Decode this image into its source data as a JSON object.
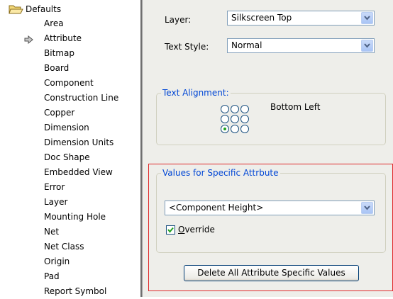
{
  "tree": {
    "root_label": "Defaults",
    "root_icon": "open-folder-icon",
    "selected_marker_icon": "arrow-right-icon",
    "items": [
      {
        "label": "Area"
      },
      {
        "label": "Attribute",
        "current": true
      },
      {
        "label": "Bitmap"
      },
      {
        "label": "Board"
      },
      {
        "label": "Component"
      },
      {
        "label": "Construction Line"
      },
      {
        "label": "Copper"
      },
      {
        "label": "Dimension"
      },
      {
        "label": "Dimension Units"
      },
      {
        "label": "Doc Shape"
      },
      {
        "label": "Embedded View"
      },
      {
        "label": "Error"
      },
      {
        "label": "Layer"
      },
      {
        "label": "Mounting Hole"
      },
      {
        "label": "Net"
      },
      {
        "label": "Net Class"
      },
      {
        "label": "Origin"
      },
      {
        "label": "Pad"
      },
      {
        "label": "Report Symbol"
      }
    ]
  },
  "settings": {
    "layer_label": "Layer:",
    "layer_value": "Silkscreen Top",
    "text_style_label": "Text Style:",
    "text_style_value": "Normal"
  },
  "text_alignment": {
    "title": "Text Alignment:",
    "selected_text": "Bottom  Left",
    "selected_position": "bottom-left"
  },
  "specific_values": {
    "title": "Values for Specific Attrbute",
    "attribute_value": "<Component Height>",
    "override_label_underlined": "O",
    "override_label_rest": "verride",
    "override_checked": true,
    "delete_button_label": "Delete All Attribute Specific Values"
  },
  "colors": {
    "group_title": "#0046d5",
    "highlight_frame": "#e0292b",
    "panel_background": "#eeeeea"
  }
}
